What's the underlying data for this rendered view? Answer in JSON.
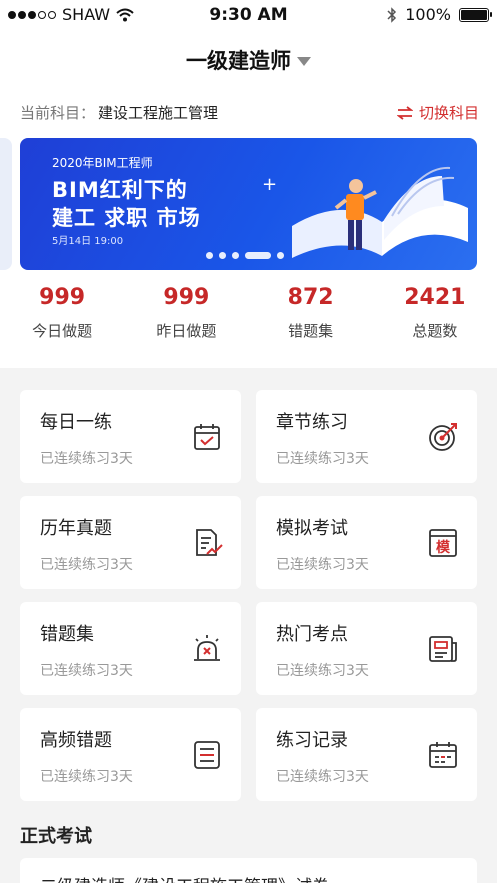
{
  "status_bar": {
    "carrier": "SHAW",
    "time": "9:30 AM",
    "battery": "100%"
  },
  "header": {
    "title": "一级建造师"
  },
  "subject": {
    "label": "当前科目：",
    "value": "建设工程施工管理",
    "switch_label": "切换科目"
  },
  "banner": {
    "subtitle": "2020年BIM工程师",
    "title_line1": "BIM红利下的",
    "title_line2": "建工 求职 市场",
    "date": "5月14日 19:00"
  },
  "stats": [
    {
      "value": "999",
      "label": "今日做题"
    },
    {
      "value": "999",
      "label": "昨日做题"
    },
    {
      "value": "872",
      "label": "错题集"
    },
    {
      "value": "2421",
      "label": "总题数"
    }
  ],
  "cards": [
    {
      "title": "每日一练",
      "subtitle": "已连续练习3天",
      "icon": "calendar-check-icon"
    },
    {
      "title": "章节练习",
      "subtitle": "已连续练习3天",
      "icon": "target-icon"
    },
    {
      "title": "历年真题",
      "subtitle": "已连续练习3天",
      "icon": "document-chart-icon"
    },
    {
      "title": "模拟考试",
      "subtitle": "已连续练习3天",
      "icon": "mock-exam-icon",
      "icon_text": "模"
    },
    {
      "title": "错题集",
      "subtitle": "已连续练习3天",
      "icon": "alarm-icon"
    },
    {
      "title": "热门考点",
      "subtitle": "已连续练习3天",
      "icon": "newspaper-icon"
    },
    {
      "title": "高频错题",
      "subtitle": "已连续练习3天",
      "icon": "list-document-icon"
    },
    {
      "title": "练习记录",
      "subtitle": "已连续练习3天",
      "icon": "calendar-record-icon"
    }
  ],
  "section": {
    "title": "正式考试"
  },
  "exam": {
    "text": "二级建造师《建设工程施工管理》试卷"
  },
  "colors": {
    "accent": "#d32f2f",
    "banner_blue": "#1a56e8"
  }
}
